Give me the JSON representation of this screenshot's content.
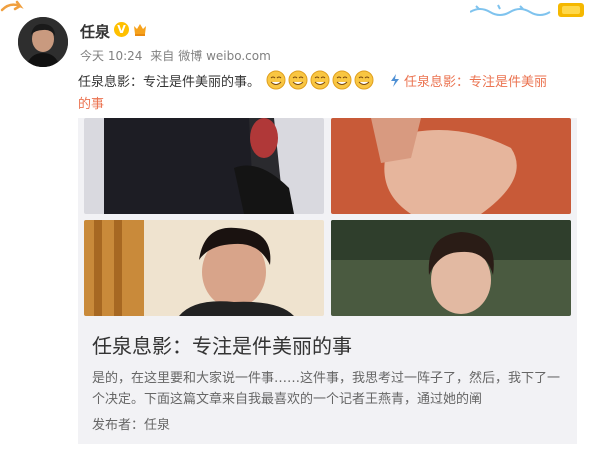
{
  "post": {
    "username": "任泉",
    "verified_badge": "V",
    "time": "今天 10:24",
    "via": "来自",
    "source": "微博 weibo.com",
    "text": "任泉息影：专注是件美丽的事。",
    "emoji_count": 5,
    "link_icon": "lightning-icon",
    "link_text_part1": "任泉息影：专注是件美丽",
    "link_text_part2": "的事"
  },
  "card": {
    "title": "任泉息影：专注是件美丽的事",
    "description": "是的，在这里要和大家说一件事……这件事，我思考过一阵子了，然后，我下了一个决定。下面这篇文章来自我最喜欢的一个记者王燕青，通过她的阐",
    "author": "发布者：任泉"
  },
  "colors": {
    "link": "#eb7350",
    "badge": "#ffc000",
    "card_bg": "#f2f2f5"
  }
}
